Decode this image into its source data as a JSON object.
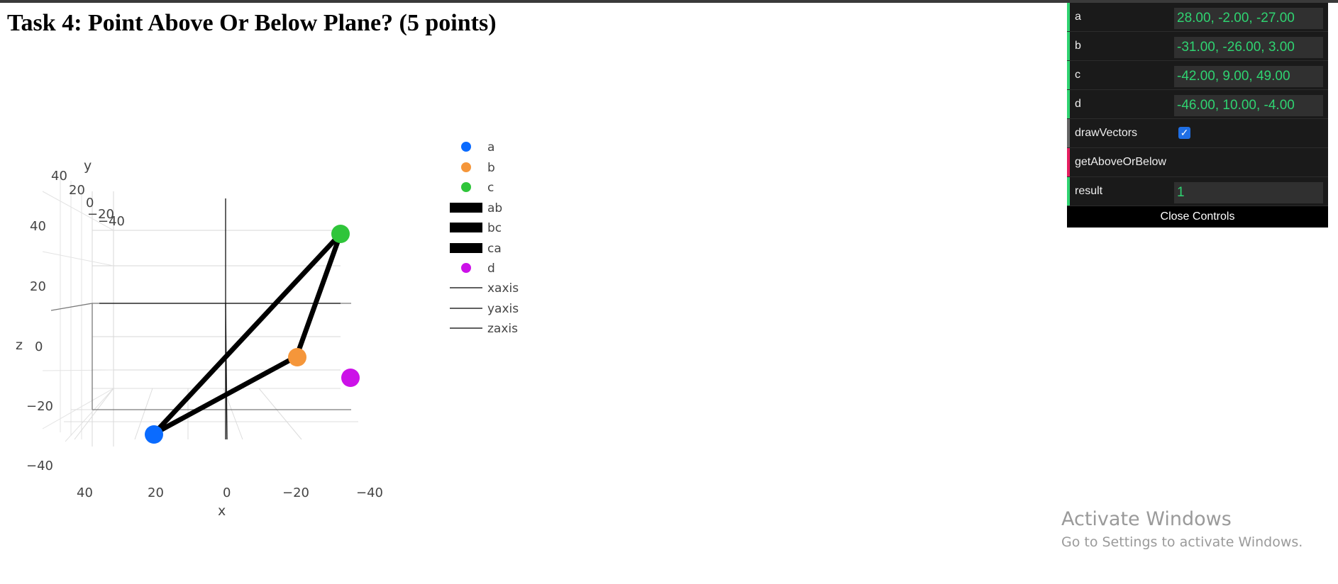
{
  "page": {
    "title": "Task 4: Point Above Or Below Plane? (5 points)"
  },
  "plot": {
    "axes": {
      "x": {
        "title": "x",
        "ticks": [
          "40",
          "20",
          "0",
          "−20",
          "−40"
        ]
      },
      "y": {
        "title": "y",
        "ticks": [
          "40",
          "20",
          "0",
          "−20",
          "−40"
        ]
      },
      "z": {
        "title": "z",
        "ticks": [
          "40",
          "20",
          "0",
          "−20",
          "−40"
        ]
      }
    },
    "legend": [
      {
        "name": "a",
        "kind": "marker",
        "color": "#0a6bff"
      },
      {
        "name": "b",
        "kind": "marker",
        "color": "#f5963a"
      },
      {
        "name": "c",
        "kind": "marker",
        "color": "#2fc53a"
      },
      {
        "name": "ab",
        "kind": "thick-line",
        "color": "#000000"
      },
      {
        "name": "bc",
        "kind": "thick-line",
        "color": "#000000"
      },
      {
        "name": "ca",
        "kind": "thick-line",
        "color": "#000000"
      },
      {
        "name": "d",
        "kind": "marker",
        "color": "#cc11e8"
      },
      {
        "name": "xaxis",
        "kind": "thin-line",
        "color": "#000000"
      },
      {
        "name": "yaxis",
        "kind": "thin-line",
        "color": "#000000"
      },
      {
        "name": "zaxis",
        "kind": "thin-line",
        "color": "#000000"
      }
    ]
  },
  "controls": {
    "a": {
      "label": "a",
      "value": "28.00, -2.00, -27.00"
    },
    "b": {
      "label": "b",
      "value": "-31.00, -26.00, 3.00"
    },
    "c": {
      "label": "c",
      "value": "-42.00, 9.00, 49.00"
    },
    "d": {
      "label": "d",
      "value": "-46.00, 10.00, -4.00"
    },
    "drawVectors": {
      "label": "drawVectors",
      "checked": true
    },
    "getAboveOrBelow": {
      "label": "getAboveOrBelow"
    },
    "result": {
      "label": "result",
      "value": "1"
    },
    "close_label": "Close Controls"
  },
  "watermark": {
    "line1": "Activate Windows",
    "line2": "Go to Settings to activate Windows."
  },
  "colors": {
    "number_green": "#2fd371",
    "stripe_green": "#2fd371",
    "stripe_gray": "#666666",
    "stripe_red": "#e61d5f"
  }
}
